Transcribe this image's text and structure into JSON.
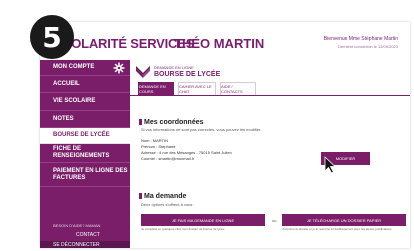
{
  "step": {
    "number": "5"
  },
  "header": {
    "app_title": "COLARITÉ SERVICES",
    "user_name": "THÉO MARTIN",
    "right_line1": "Bienvenue Mme Stéphane Martin",
    "right_line2": "Dernière connexion le 12/09/2023"
  },
  "sidebar": {
    "items": [
      {
        "label": "MON COMPTE"
      },
      {
        "label": "ACCUEIL"
      },
      {
        "label": "VIE SCOLAIRE"
      },
      {
        "label": "NOTES"
      },
      {
        "label": "BOURSE DE LYCÉE"
      },
      {
        "label": "FICHE DE RENSEIGNEMENTS"
      },
      {
        "label": "PAIEMENT EN LIGNE DES FACTURES"
      }
    ],
    "note": "BESOIN D'AIDE? MAMAN",
    "contact_label": "CONTACT",
    "footer_label": "SE DÉCONNECTER"
  },
  "content": {
    "page_supertitle": "DEMANDE EN LIGNE",
    "page_title": "BOURSE DE LYCÉE",
    "tabs": [
      {
        "label": "DEMANDE EN COURS"
      },
      {
        "label": "CAHIER AVEC LE CHAT"
      },
      {
        "label": "AIDE / CONTACTS"
      }
    ],
    "section1": {
      "heading": "Mes coordonnées",
      "subtext": "Si vos informations ne sont pas correctes, vous pouvez les modifier.",
      "lines": [
        "Nom : MARTIN",
        "Prénom : Stéphane",
        "Adresse : 4 rue des Mésanges - 75015 Saint Julien",
        "Courriel : smartin@monmail.fr"
      ],
      "modify_button": "MODIFIER"
    },
    "section2": {
      "heading": "Ma demande",
      "subtext": "Deux options s'offrent à vous :",
      "button_left": "JE FAIS MA DEMANDE EN LIGNE",
      "button_right": "JE TÉLÉCHARGE UN DOSSIER PAPIER",
      "or_label": "ou",
      "note_left": "Je complète en quelques clics mon dossier de bourse de lycée",
      "note_right": "J'imprime le dossier et je le retourne à l'établissement avec les pièces justificatives"
    }
  },
  "colors": {
    "accent": "#7b1e69",
    "badge": "#1a1a1a"
  },
  "icons": {
    "gear": "gear-icon",
    "page": "school-icon",
    "cursor": "mouse-cursor-icon"
  }
}
